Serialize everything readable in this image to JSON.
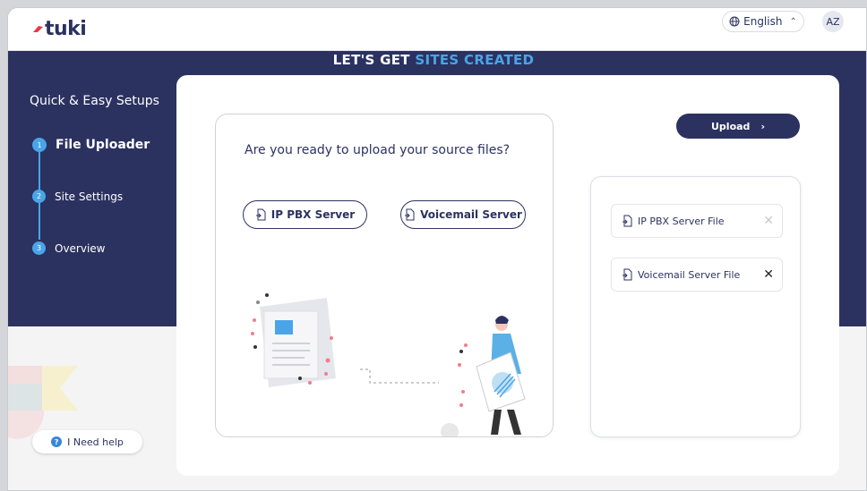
{
  "app": {
    "logo_text": "tuki"
  },
  "header": {
    "language": "English",
    "avatar_initials": "AZ"
  },
  "banner": {
    "title_prefix": "LET'S GET ",
    "title_accent": "SITES CREATED"
  },
  "sidebar": {
    "heading": "Quick & Easy Setups",
    "steps": [
      {
        "number": "1",
        "label": "File Uploader",
        "active": true
      },
      {
        "number": "2",
        "label": "Site Settings",
        "active": false
      },
      {
        "number": "3",
        "label": "Overview",
        "active": false
      }
    ],
    "help_label": "I Need help"
  },
  "main": {
    "question": "Are you ready to upload your source files?",
    "buttons": {
      "ip_pbx": "IP PBX Server",
      "voicemail": "Voicemail Server"
    },
    "upload_label": "Upload",
    "files": [
      {
        "label": "IP PBX Server File",
        "remove_enabled": false
      },
      {
        "label": "Voicemail Server File",
        "remove_enabled": true
      }
    ]
  },
  "colors": {
    "navy": "#2b3260",
    "accent_blue": "#4aa4e8",
    "logo_red": "#e8394a"
  },
  "icons": {
    "language": "globe-icon",
    "caret": "chevron-up-icon",
    "file_upload": "file-upload-icon",
    "upload_arrow": "chevron-right-icon",
    "remove": "close-icon",
    "help": "question-circle-icon"
  }
}
